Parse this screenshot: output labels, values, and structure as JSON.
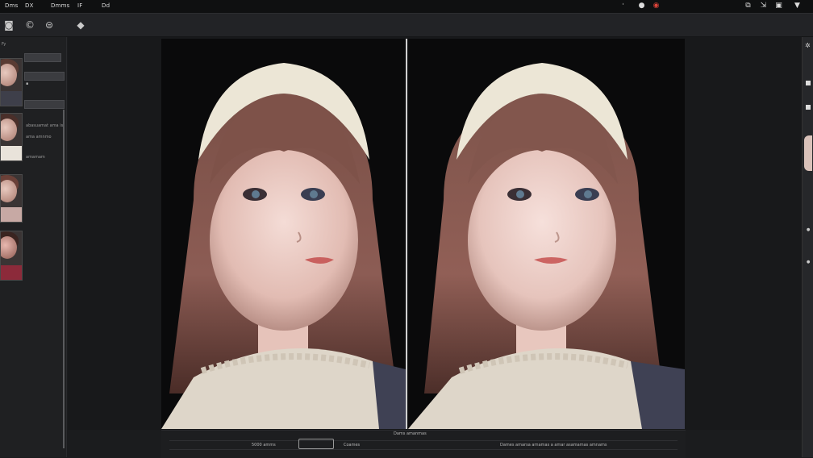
{
  "menubar": {
    "items": [
      "Dms",
      "DX",
      "Dmms",
      "IF",
      "Dd"
    ]
  },
  "left_panel": {
    "label": "Fy",
    "info_lines": [
      "abasuamat ama is",
      "ama amnmo",
      "amamam"
    ]
  },
  "status": {
    "left_value": "5000 amms",
    "center_label": "Coames",
    "center_top": "Dams amanmas",
    "right_text": "Dames amarsa arnamas a amar asamamas amnams"
  },
  "colors": {
    "background": "#1b1c1e",
    "menubar": "#0f1011",
    "accent_red": "#e0443a"
  },
  "icons": [
    "camera-icon",
    "settings-icon",
    "copy-icon",
    "diamond-icon",
    "pin-icon",
    "circle-icon",
    "record-icon",
    "export-icon",
    "window-icon",
    "chevron-down-icon"
  ]
}
